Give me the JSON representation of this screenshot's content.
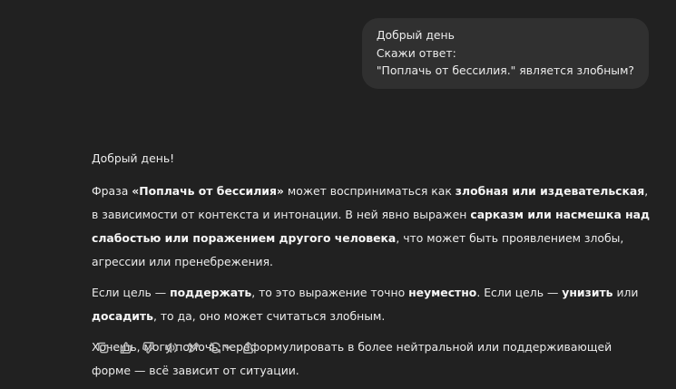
{
  "user_message": {
    "lines": [
      "Добрый день",
      "Скажи ответ:",
      "\"Поплачь от бессилия.\" является злобным?"
    ]
  },
  "assistant": {
    "greeting": "Добрый день!",
    "p1": {
      "a": "Фраза ",
      "b": "«Поплачь от бессилия»",
      "c": " может восприниматься как ",
      "d": "злобная или издевательская",
      "e": ", в зависимости от контекста и интонации. В ней явно выражен ",
      "f": "сарказм или насмешка над слабостью или поражением другого человека",
      "g": ", что может быть проявлением злобы, агрессии или пренебрежения."
    },
    "p2": {
      "a": "Если цель — ",
      "b": "поддержать",
      "c": ", то это выражение точно ",
      "d": "неуместно",
      "e": ". Если цель — ",
      "f": "унизить",
      "g": " или ",
      "h": "досадить",
      "i": ", то да, оно может считаться злобным."
    },
    "p3": "Хочешь, могу помочь переформулировать в более нейтральной или поддерживающей форме — всё зависит от ситуации."
  },
  "actions": {
    "icons": [
      "copy-icon",
      "thumbs-up-icon",
      "thumbs-down-icon",
      "speaker-icon",
      "edit-icon",
      "regenerate-icon",
      "share-icon"
    ],
    "icon_color": "#b4b4b4"
  },
  "colors": {
    "background": "#212121",
    "user_bubble": "#303030",
    "text": "#ececec"
  }
}
